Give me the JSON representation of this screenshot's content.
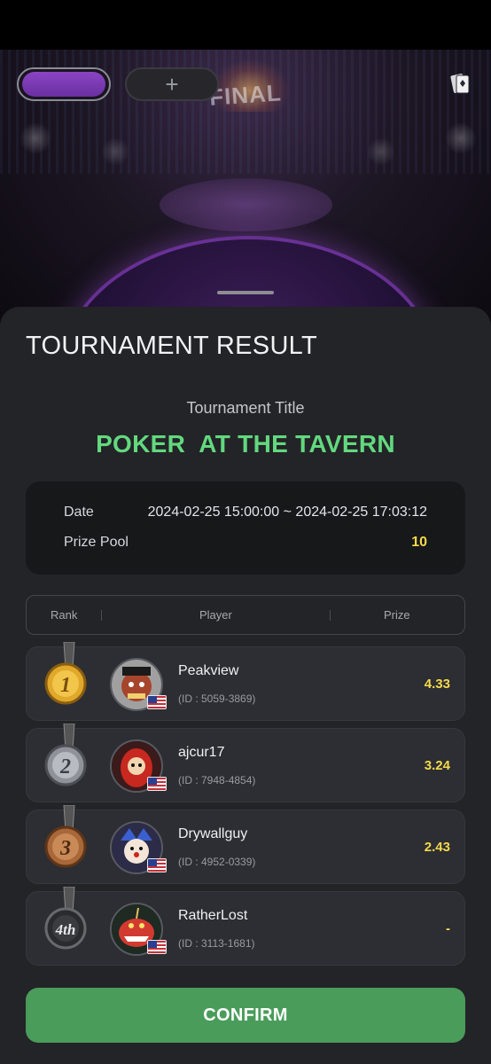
{
  "header": {
    "add_tab_label": "+",
    "stage_sign": "FINAL"
  },
  "sheet": {
    "title": "TOURNAMENT RESULT",
    "tournament_label": "Tournament Title",
    "tournament_name": "POKER  AT THE TAVERN",
    "info": {
      "date_label": "Date",
      "date_value": "2024-02-25 15:00:00 ~ 2024-02-25 17:03:12",
      "prize_pool_label": "Prize Pool",
      "prize_pool_value": "10"
    },
    "table": {
      "headers": [
        "Rank",
        "Player",
        "Prize"
      ],
      "rows": [
        {
          "rank": "1",
          "medal": "gold-medal-icon",
          "name": "Peakview",
          "id": "(ID : 5059-3869)",
          "prize": "4.33",
          "avatar": "ogre-avatar",
          "flag": "us-flag-icon"
        },
        {
          "rank": "2",
          "medal": "silver-medal-icon",
          "name": "ajcur17",
          "id": "(ID : 7948-4854)",
          "prize": "3.24",
          "avatar": "daruma-avatar",
          "flag": "us-flag-icon"
        },
        {
          "rank": "3",
          "medal": "bronze-medal-icon",
          "name": "Drywallguy",
          "id": "(ID : 4952-0339)",
          "prize": "2.43",
          "avatar": "joker-avatar",
          "flag": "us-flag-icon"
        },
        {
          "rank": "4th",
          "medal": "fourth-place-medal-icon",
          "name": "RatherLost",
          "id": "(ID : 3113-1681)",
          "prize": "-",
          "avatar": "monster-fish-avatar",
          "flag": "us-flag-icon"
        }
      ]
    },
    "confirm_label": "CONFIRM"
  },
  "colors": {
    "accent_green": "#62d97f",
    "prize_yellow": "#f5d94a",
    "confirm_green": "#4a9c5a",
    "sheet_bg": "#232427",
    "tab_purple": "#8a45c2"
  }
}
